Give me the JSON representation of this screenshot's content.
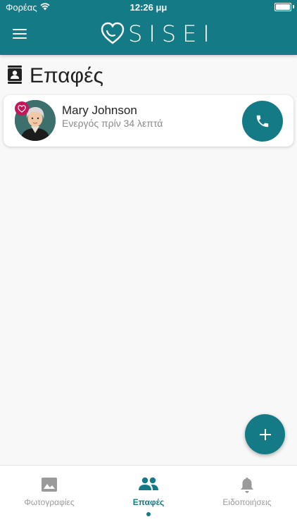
{
  "status_bar": {
    "carrier": "Φορέας",
    "time": "12:26 μμ"
  },
  "header": {
    "logo_text": "SISEI",
    "menu_icon": "hamburger-icon"
  },
  "page": {
    "title": "Επαφές",
    "title_icon": "contacts-book-icon"
  },
  "contacts": [
    {
      "name": "Mary Johnson",
      "status": "Ενεργός πρίν 34 λεπτά",
      "badge_icon": "heart-icon",
      "call_icon": "phone-icon"
    }
  ],
  "fab": {
    "icon": "plus-icon"
  },
  "tabs": [
    {
      "label": "Φωτογραφίες",
      "icon": "image-icon",
      "active": false
    },
    {
      "label": "Επαφές",
      "icon": "people-icon",
      "active": true
    },
    {
      "label": "Ειδοποιήσεις",
      "icon": "bell-icon",
      "active": false
    }
  ],
  "colors": {
    "primary": "#147a85",
    "badge": "#c2185b",
    "background": "#f8f8f8"
  }
}
